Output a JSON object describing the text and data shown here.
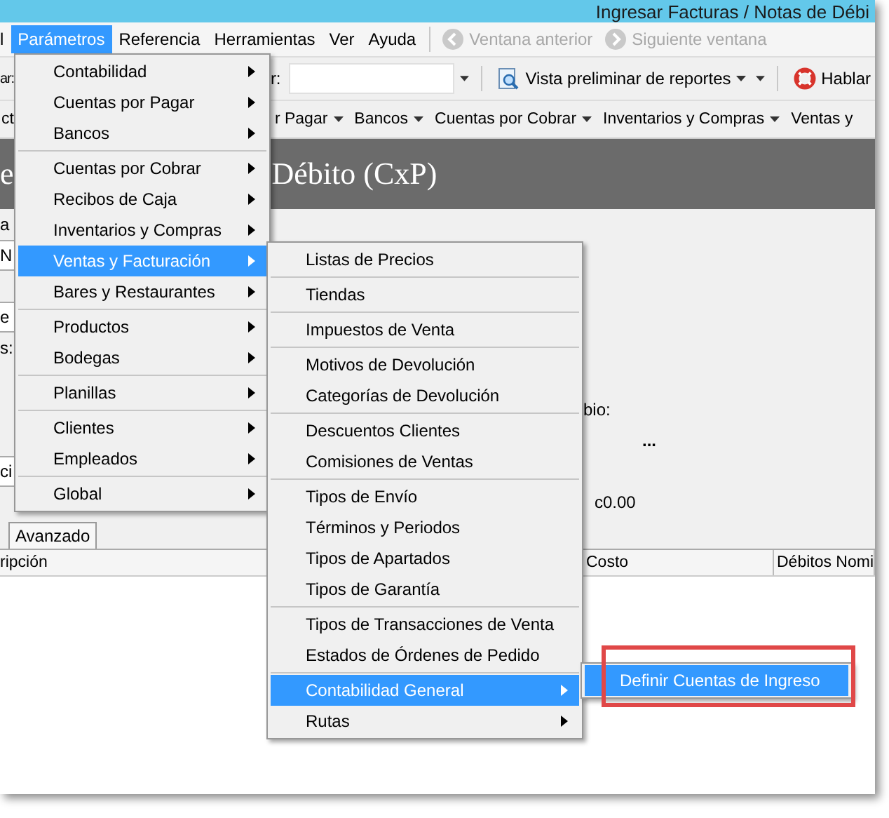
{
  "window": {
    "title": "Ingresar Facturas / Notas de Débi"
  },
  "menu_bar": {
    "items": [
      {
        "label": "l",
        "selected": false
      },
      {
        "label": "Parámetros",
        "selected": true
      },
      {
        "label": "Referencia",
        "selected": false
      },
      {
        "label": "Herramientas",
        "selected": false
      },
      {
        "label": "Ver",
        "selected": false
      },
      {
        "label": "Ayuda",
        "selected": false
      }
    ],
    "nav_buttons": [
      {
        "label": "Ventana anterior",
        "disabled": true
      },
      {
        "label": "Siguiente ventana",
        "disabled": true
      }
    ]
  },
  "toolbar": {
    "label_1": "ar:",
    "label_2": "r:",
    "report_button": "Vista preliminar de reportes",
    "help_button": "Hablar"
  },
  "module_bar": {
    "items": [
      "ct",
      "r Pagar",
      "Bancos",
      "Cuentas por Cobrar",
      "Inventarios y Compras",
      "Ventas y"
    ]
  },
  "header": {
    "fragment": "e",
    "title": "Débito (CxP)"
  },
  "form": {
    "fragments": [
      "a",
      "N",
      "e",
      "s:",
      "ci",
      "bio:",
      "...",
      "c0.00"
    ]
  },
  "tabs": [
    "Avanzado"
  ],
  "table": {
    "columns": [
      "ripción",
      "Costo",
      "Débitos Nomi"
    ]
  },
  "menus": [
    {
      "groups": [
        [
          {
            "label": "Contabilidad",
            "submenu": true,
            "selected": false
          },
          {
            "label": "Cuentas por Pagar",
            "submenu": true,
            "selected": false
          },
          {
            "label": "Bancos",
            "submenu": true,
            "selected": false
          }
        ],
        [
          {
            "label": "Cuentas por Cobrar",
            "submenu": true,
            "selected": false
          },
          {
            "label": "Recibos de Caja",
            "submenu": true,
            "selected": false
          },
          {
            "label": "Inventarios y Compras",
            "submenu": true,
            "selected": false
          },
          {
            "label": "Ventas y Facturación",
            "submenu": true,
            "selected": true
          },
          {
            "label": "Bares y Restaurantes",
            "submenu": true,
            "selected": false
          }
        ],
        [
          {
            "label": "Productos",
            "submenu": true,
            "selected": false
          },
          {
            "label": "Bodegas",
            "submenu": true,
            "selected": false
          }
        ],
        [
          {
            "label": "Planillas",
            "submenu": true,
            "selected": false
          }
        ],
        [
          {
            "label": "Clientes",
            "submenu": true,
            "selected": false
          },
          {
            "label": "Empleados",
            "submenu": true,
            "selected": false
          }
        ],
        [
          {
            "label": "Global",
            "submenu": true,
            "selected": false
          }
        ]
      ]
    },
    {
      "groups": [
        [
          {
            "label": "Listas de Precios",
            "submenu": false,
            "selected": false
          }
        ],
        [
          {
            "label": "Tiendas",
            "submenu": false,
            "selected": false
          }
        ],
        [
          {
            "label": "Impuestos de Venta",
            "submenu": false,
            "selected": false
          }
        ],
        [
          {
            "label": "Motivos de Devolución",
            "submenu": false,
            "selected": false
          },
          {
            "label": "Categorías de Devolución",
            "submenu": false,
            "selected": false
          }
        ],
        [
          {
            "label": "Descuentos Clientes",
            "submenu": false,
            "selected": false
          },
          {
            "label": "Comisiones de Ventas",
            "submenu": false,
            "selected": false
          }
        ],
        [
          {
            "label": "Tipos de Envío",
            "submenu": false,
            "selected": false
          },
          {
            "label": "Términos y Periodos",
            "submenu": false,
            "selected": false
          },
          {
            "label": "Tipos de Apartados",
            "submenu": false,
            "selected": false
          },
          {
            "label": "Tipos de Garantía",
            "submenu": false,
            "selected": false
          }
        ],
        [
          {
            "label": "Tipos de Transacciones de Venta",
            "submenu": false,
            "selected": false
          },
          {
            "label": "Estados de Órdenes de Pedido",
            "submenu": false,
            "selected": false
          }
        ],
        [
          {
            "label": "Contabilidad General",
            "submenu": true,
            "selected": true
          },
          {
            "label": "Rutas",
            "submenu": true,
            "selected": false
          }
        ]
      ]
    },
    {
      "groups": [
        [
          {
            "label": "Definir Cuentas de Ingreso",
            "submenu": false,
            "selected": true
          }
        ]
      ]
    }
  ]
}
